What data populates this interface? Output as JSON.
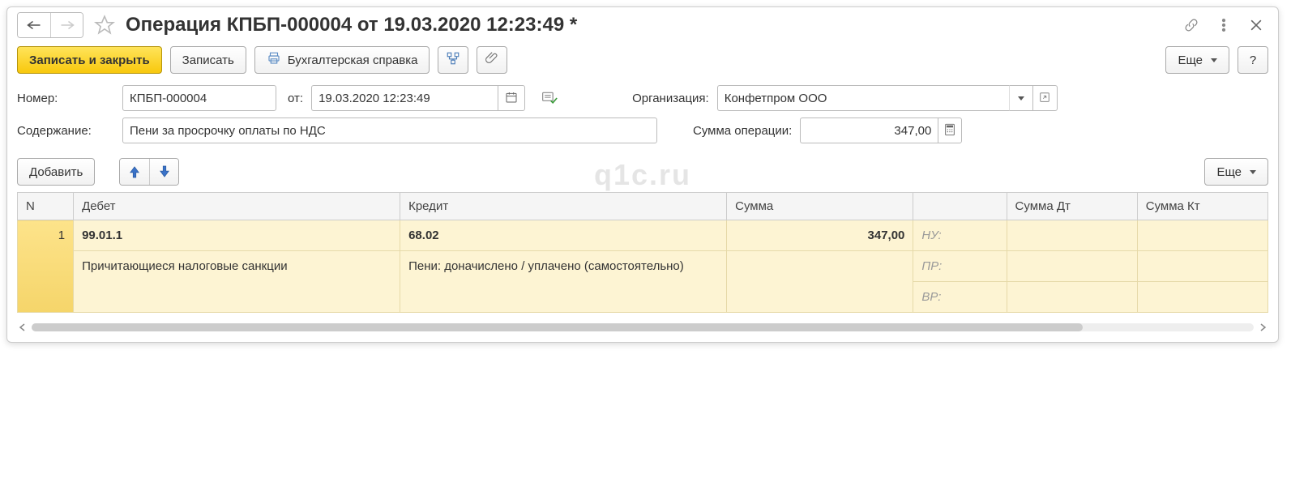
{
  "title": "Операция КПБП-000004 от 19.03.2020 12:23:49 *",
  "toolbar": {
    "write_close": "Записать и закрыть",
    "write": "Записать",
    "accounting_ref": "Бухгалтерская справка",
    "more": "Еще",
    "help": "?"
  },
  "form": {
    "number_label": "Номер:",
    "number_value": "КПБП-000004",
    "date_label": "от:",
    "date_value": "19.03.2020 12:23:49",
    "org_label": "Организация:",
    "org_value": "Конфетпром ООО",
    "content_label": "Содержание:",
    "content_value": "Пени за просрочку оплаты по НДС",
    "total_label": "Сумма операции:",
    "total_value": "347,00"
  },
  "table_toolbar": {
    "add": "Добавить",
    "more": "Еще"
  },
  "table": {
    "headers": {
      "n": "N",
      "debit": "Дебет",
      "credit": "Кредит",
      "sum": "Сумма",
      "sum_dt": "Сумма Дт",
      "sum_kt": "Сумма Кт"
    },
    "rows": [
      {
        "n": "1",
        "debit_acct": "99.01.1",
        "debit_desc": "Причитающиеся налоговые санкции",
        "credit_acct": "68.02",
        "credit_desc": "Пени: доначислено / уплачено (самостоятельно)",
        "sum": "347,00",
        "nu": "НУ:",
        "pr": "ПР:",
        "vr": "ВР:"
      }
    ]
  },
  "watermark": "q1c.ru"
}
